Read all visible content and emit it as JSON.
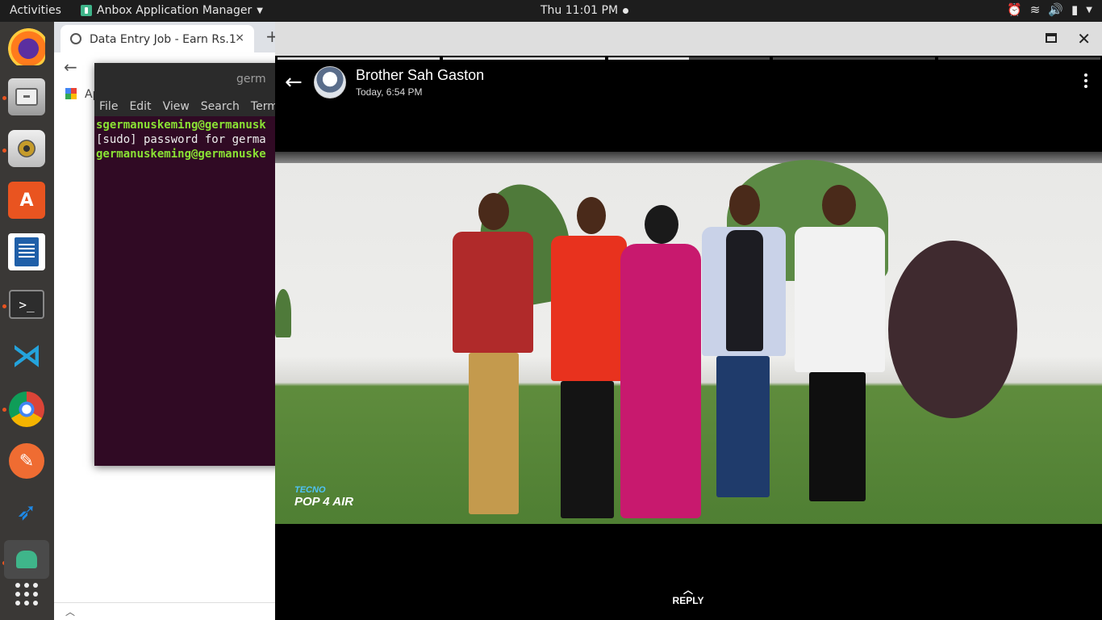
{
  "topbar": {
    "activities": "Activities",
    "app_menu": "Anbox Application Manager",
    "clock": "Thu 11:01 PM"
  },
  "dock": {
    "items": [
      "firefox-icon",
      "files-icon",
      "rhythmbox-icon",
      "software-store-icon",
      "writer-icon",
      "terminal-icon",
      "vscode-icon",
      "chrome-icon",
      "postman-icon",
      "bird-app-icon",
      "anbox-icon",
      "show-apps-icon"
    ]
  },
  "browser": {
    "tab_title": "Data Entry Job - Earn Rs.1",
    "bookmarks_apps": "Ap"
  },
  "terminal": {
    "title": "germ",
    "menu": [
      "File",
      "Edit",
      "View",
      "Search",
      "Termi"
    ],
    "lines": [
      "sgermanuskeming@germanusk",
      "[sudo] password for germa",
      "germanuskeming@germanuske"
    ]
  },
  "status": {
    "contact_name": "Brother Sah Gaston",
    "timestamp": "Today, 6:54 PM",
    "watermark_brand": "TECNO",
    "watermark_model": "POP 4 AIR",
    "reply_label": "REPLY"
  },
  "colors": {
    "ubuntu_orange": "#e95420",
    "terminal_bg": "#300a24",
    "prompt_green": "#8ae234"
  }
}
